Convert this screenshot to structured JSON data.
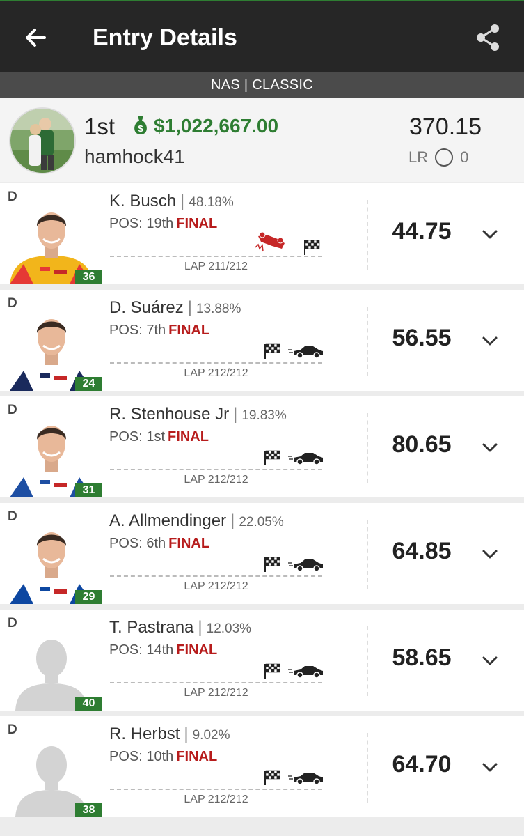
{
  "header": {
    "title": "Entry Details",
    "subtitle": "NAS | CLASSIC"
  },
  "entry": {
    "rank": "1st",
    "winnings": "$1,022,667.00",
    "username": "hamhock41",
    "score": "370.15",
    "lr_label": "LR",
    "lr_value": "0"
  },
  "colors": {
    "accent": "#2e7d32",
    "final": "#b71c1c",
    "appbar": "#262626"
  },
  "drivers": [
    {
      "position": "D",
      "name": "K. Busch",
      "ownership": "48.18%",
      "pos_label": "POS:",
      "pos": "19th",
      "status": "FINAL",
      "lap": "LAP 211/212",
      "points": "44.75",
      "car_number": "36",
      "icons": [
        "crash-icon",
        "checkered-flag-icon"
      ],
      "suit": "#f2b51b",
      "trim": "#e53935"
    },
    {
      "position": "D",
      "name": "D. Suárez",
      "ownership": "13.88%",
      "pos_label": "POS:",
      "pos": "7th",
      "status": "FINAL",
      "lap": "LAP 212/212",
      "points": "56.55",
      "car_number": "24",
      "icons": [
        "checkered-flag-icon",
        "race-car-icon"
      ],
      "suit": "#ffffff",
      "trim": "#1a2a5c"
    },
    {
      "position": "D",
      "name": "R. Stenhouse Jr",
      "ownership": "19.83%",
      "pos_label": "POS:",
      "pos": "1st",
      "status": "FINAL",
      "lap": "LAP 212/212",
      "points": "80.65",
      "car_number": "31",
      "icons": [
        "checkered-flag-icon",
        "race-car-icon"
      ],
      "suit": "#ffffff",
      "trim": "#1e4fa3"
    },
    {
      "position": "D",
      "name": "A. Allmendinger",
      "ownership": "22.05%",
      "pos_label": "POS:",
      "pos": "6th",
      "status": "FINAL",
      "lap": "LAP 212/212",
      "points": "64.85",
      "car_number": "29",
      "icons": [
        "checkered-flag-icon",
        "race-car-icon"
      ],
      "suit": "#ffffff",
      "trim": "#0d47a1"
    },
    {
      "position": "D",
      "name": "T. Pastrana",
      "ownership": "12.03%",
      "pos_label": "POS:",
      "pos": "14th",
      "status": "FINAL",
      "lap": "LAP 212/212",
      "points": "58.65",
      "car_number": "40",
      "icons": [
        "checkered-flag-icon",
        "race-car-icon"
      ],
      "suit": "",
      "trim": ""
    },
    {
      "position": "D",
      "name": "R. Herbst",
      "ownership": "9.02%",
      "pos_label": "POS:",
      "pos": "10th",
      "status": "FINAL",
      "lap": "LAP 212/212",
      "points": "64.70",
      "car_number": "38",
      "icons": [
        "checkered-flag-icon",
        "race-car-icon"
      ],
      "suit": "",
      "trim": ""
    }
  ]
}
